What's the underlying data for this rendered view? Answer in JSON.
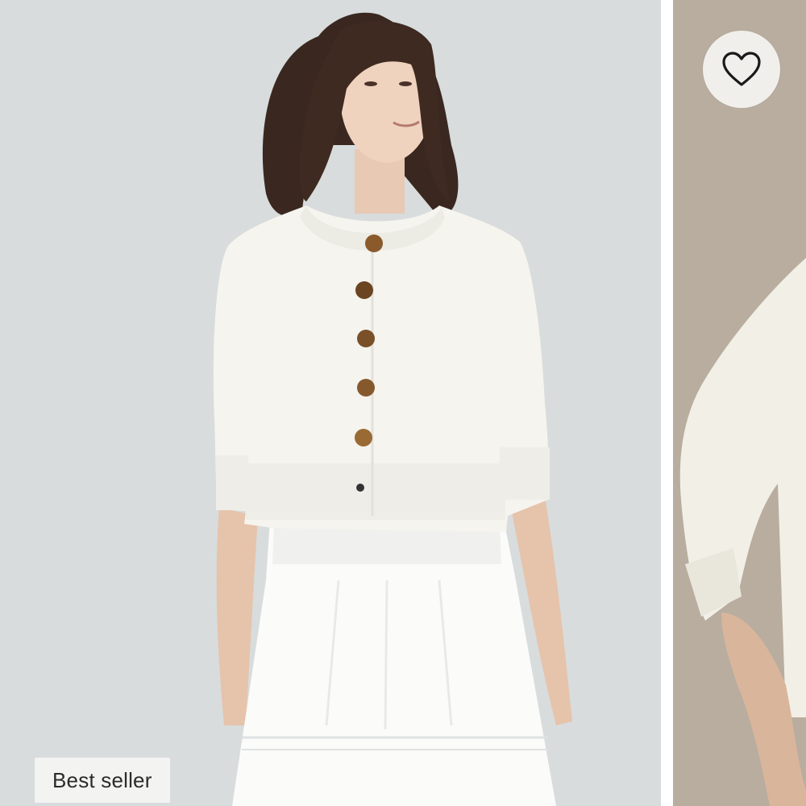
{
  "product_gallery": {
    "badge_label": "Best seller",
    "favorite_icon": "heart-outline-icon",
    "images": [
      {
        "name": "model-front-view",
        "background": "#d8dcdc"
      },
      {
        "name": "model-side-view",
        "background": "#b8ad9f"
      }
    ]
  }
}
